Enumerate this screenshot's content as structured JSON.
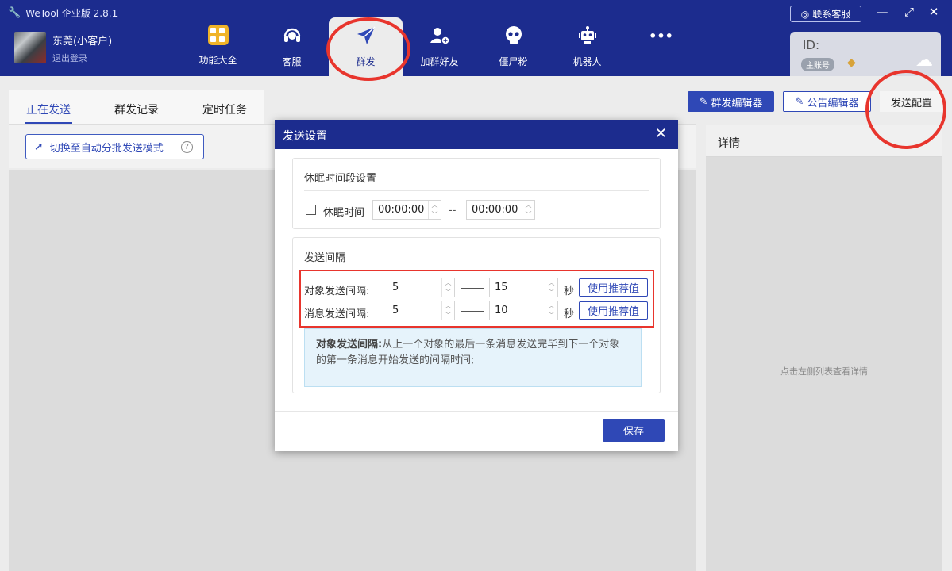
{
  "app": {
    "title": "WeTool 企业版 2.8.1",
    "support": "联系客服"
  },
  "user": {
    "name": "东莞(小客户)",
    "logout": "退出登录"
  },
  "nav": [
    {
      "label": "功能大全",
      "icon": "grid-icon"
    },
    {
      "label": "客服",
      "icon": "headset-icon"
    },
    {
      "label": "群发",
      "icon": "send-icon",
      "active": true
    },
    {
      "label": "加群好友",
      "icon": "add-user-icon"
    },
    {
      "label": "僵尸粉",
      "icon": "skull-icon"
    },
    {
      "label": "机器人",
      "icon": "robot-icon"
    },
    {
      "label": "",
      "icon": "more-icon"
    }
  ],
  "account": {
    "id_label": "ID:",
    "badge": "主账号"
  },
  "tabs": [
    "正在发送",
    "群发记录",
    "定时任务"
  ],
  "toolbar": {
    "auto_mode": "切换至自动分批发送模式",
    "help": "?"
  },
  "top_buttons": {
    "editor": "群发编辑器",
    "notice": "公告编辑器",
    "config": "发送配置"
  },
  "details": {
    "title": "详情",
    "hint": "点击左侧列表查看详情"
  },
  "modal": {
    "title": "发送设置",
    "sleep_section": {
      "title": "休眠时间段设置",
      "checkbox_label": "休眠时间",
      "start": "00:00:00",
      "separator": "--",
      "end": "00:00:00"
    },
    "interval_section": {
      "title": "发送间隔",
      "rows": [
        {
          "label": "对象发送间隔:",
          "min": "5",
          "max": "15",
          "unit": "秒",
          "button": "使用推荐值"
        },
        {
          "label": "消息发送间隔:",
          "min": "5",
          "max": "10",
          "unit": "秒",
          "button": "使用推荐值"
        }
      ],
      "info_bold": "对象发送间隔:",
      "info_text": "从上一个对象的最后一条消息发送完毕到下一个对象的第一条消息开始发送的间隔时间;"
    },
    "save": "保存"
  },
  "colors": {
    "header": "#1c2c8e",
    "accent": "#2f48b6",
    "annotation": "#e8352d"
  }
}
